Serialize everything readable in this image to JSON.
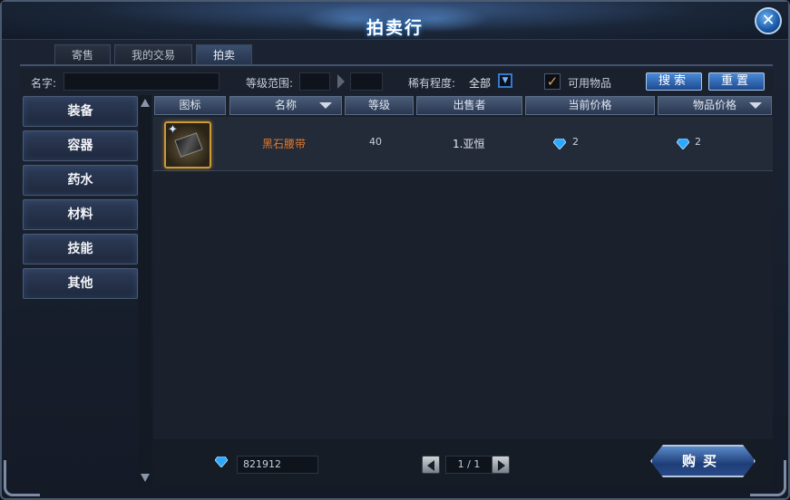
{
  "window": {
    "title": "拍卖行",
    "close_icon": "close-icon"
  },
  "tabs": [
    {
      "label": "寄售",
      "active": false
    },
    {
      "label": "我的交易",
      "active": false
    },
    {
      "label": "拍卖",
      "active": true
    }
  ],
  "filters": {
    "name_label": "名字:",
    "name_value": "",
    "level_label": "等级范围:",
    "level_min": "",
    "level_max": "",
    "rarity_label": "稀有程度:",
    "rarity_value": "全部",
    "usable_label": "可用物品",
    "usable_checked": true,
    "search_label": "搜索",
    "reset_label": "重置"
  },
  "categories": [
    "装备",
    "容器",
    "药水",
    "材料",
    "技能",
    "其他"
  ],
  "columns": [
    "图标",
    "名称",
    "等级",
    "出售者",
    "当前价格",
    "物品价格"
  ],
  "rows": [
    {
      "icon": "belt-item-icon",
      "name": "黑石腰带",
      "level": "40",
      "seller": "1.亚恒",
      "current_price": "2",
      "item_price": "2"
    }
  ],
  "footer": {
    "currency_icon": "diamond-icon",
    "balance": "821912",
    "page": "1 / 1",
    "buy_label": "购买"
  },
  "colors": {
    "item_name": "#e07a2e",
    "diamond": "#2ea8ff",
    "accent_blue": "#2f7ad0"
  }
}
